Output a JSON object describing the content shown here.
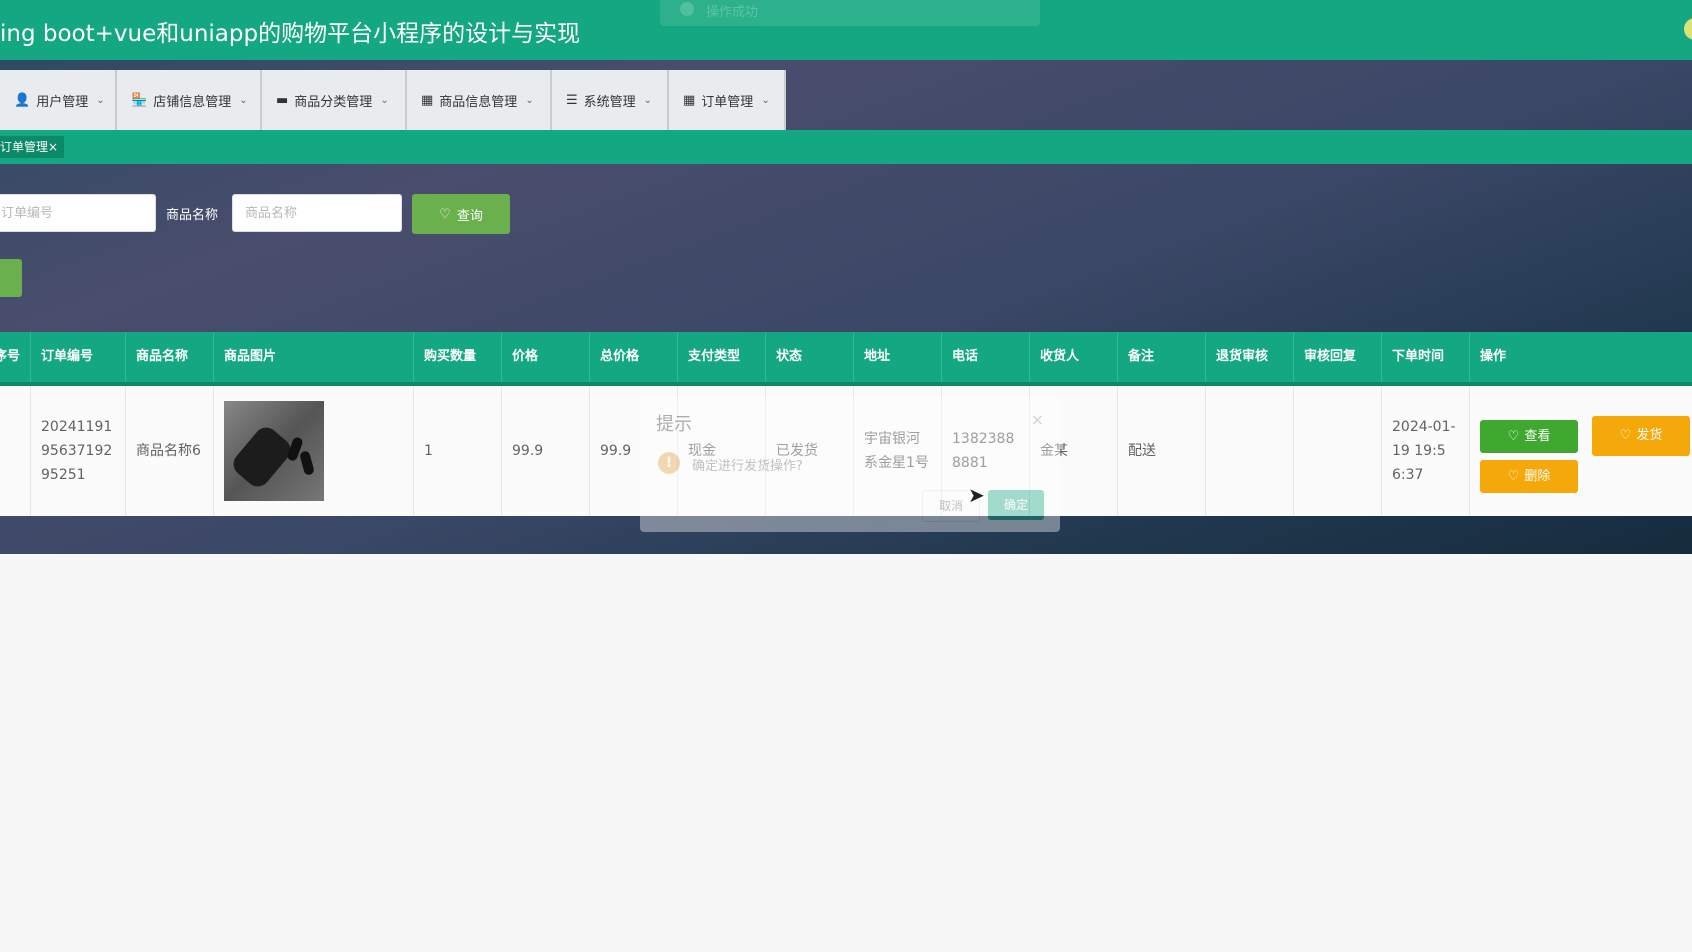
{
  "header": {
    "title": "ing boot+vue和uniapp的购物平台小程序的设计与实现",
    "toast_text": "操作成功"
  },
  "nav": {
    "items": [
      {
        "icon": "user-icon",
        "glyph": "👤",
        "label": "用户管理"
      },
      {
        "icon": "store-icon",
        "glyph": "🏪",
        "label": "店铺信息管理"
      },
      {
        "icon": "monitor-icon",
        "glyph": "▬",
        "label": "商品分类管理"
      },
      {
        "icon": "grid-icon",
        "glyph": "▦",
        "label": "商品信息管理"
      },
      {
        "icon": "list-icon",
        "glyph": "☰",
        "label": "系统管理"
      },
      {
        "icon": "grid-icon",
        "glyph": "▦",
        "label": "订单管理"
      }
    ]
  },
  "tags": {
    "active": "订单管理",
    "close": "×"
  },
  "search": {
    "order_placeholder": "订单编号",
    "product_label": "商品名称",
    "product_placeholder": "商品名称",
    "query_label": "查询",
    "query_icon": "♡"
  },
  "table": {
    "columns": [
      "序号",
      "订单编号",
      "商品名称",
      "商品图片",
      "购买数量",
      "价格",
      "总价格",
      "支付类型",
      "状态",
      "地址",
      "电话",
      "收货人",
      "备注",
      "退货审核",
      "审核回复",
      "下单时间",
      "操作"
    ],
    "rows": [
      {
        "index": "",
        "order_no": "202411919563719295251",
        "product_name": "商品名称6",
        "quantity": "1",
        "price": "99.9",
        "total": "99.9",
        "pay_type": "现金",
        "status": "已发货",
        "address": "宇宙银河系金星1号",
        "phone": "13823888881",
        "receiver": "金某",
        "remark": "配送",
        "return_review": "",
        "review_reply": "",
        "order_time": "2024-01-19 19:56:37",
        "actions": {
          "view": "查看",
          "ship": "发货",
          "delete": "删除"
        }
      }
    ]
  },
  "dialog": {
    "title": "提示",
    "message": "确定进行发货操作?",
    "cancel": "取消",
    "confirm": "确定",
    "close": "×",
    "warn": "!"
  },
  "colors": {
    "primary": "#14a882",
    "green_btn": "#3fa82f",
    "orange_btn": "#f5a80a",
    "query_btn": "#6ab04c"
  }
}
